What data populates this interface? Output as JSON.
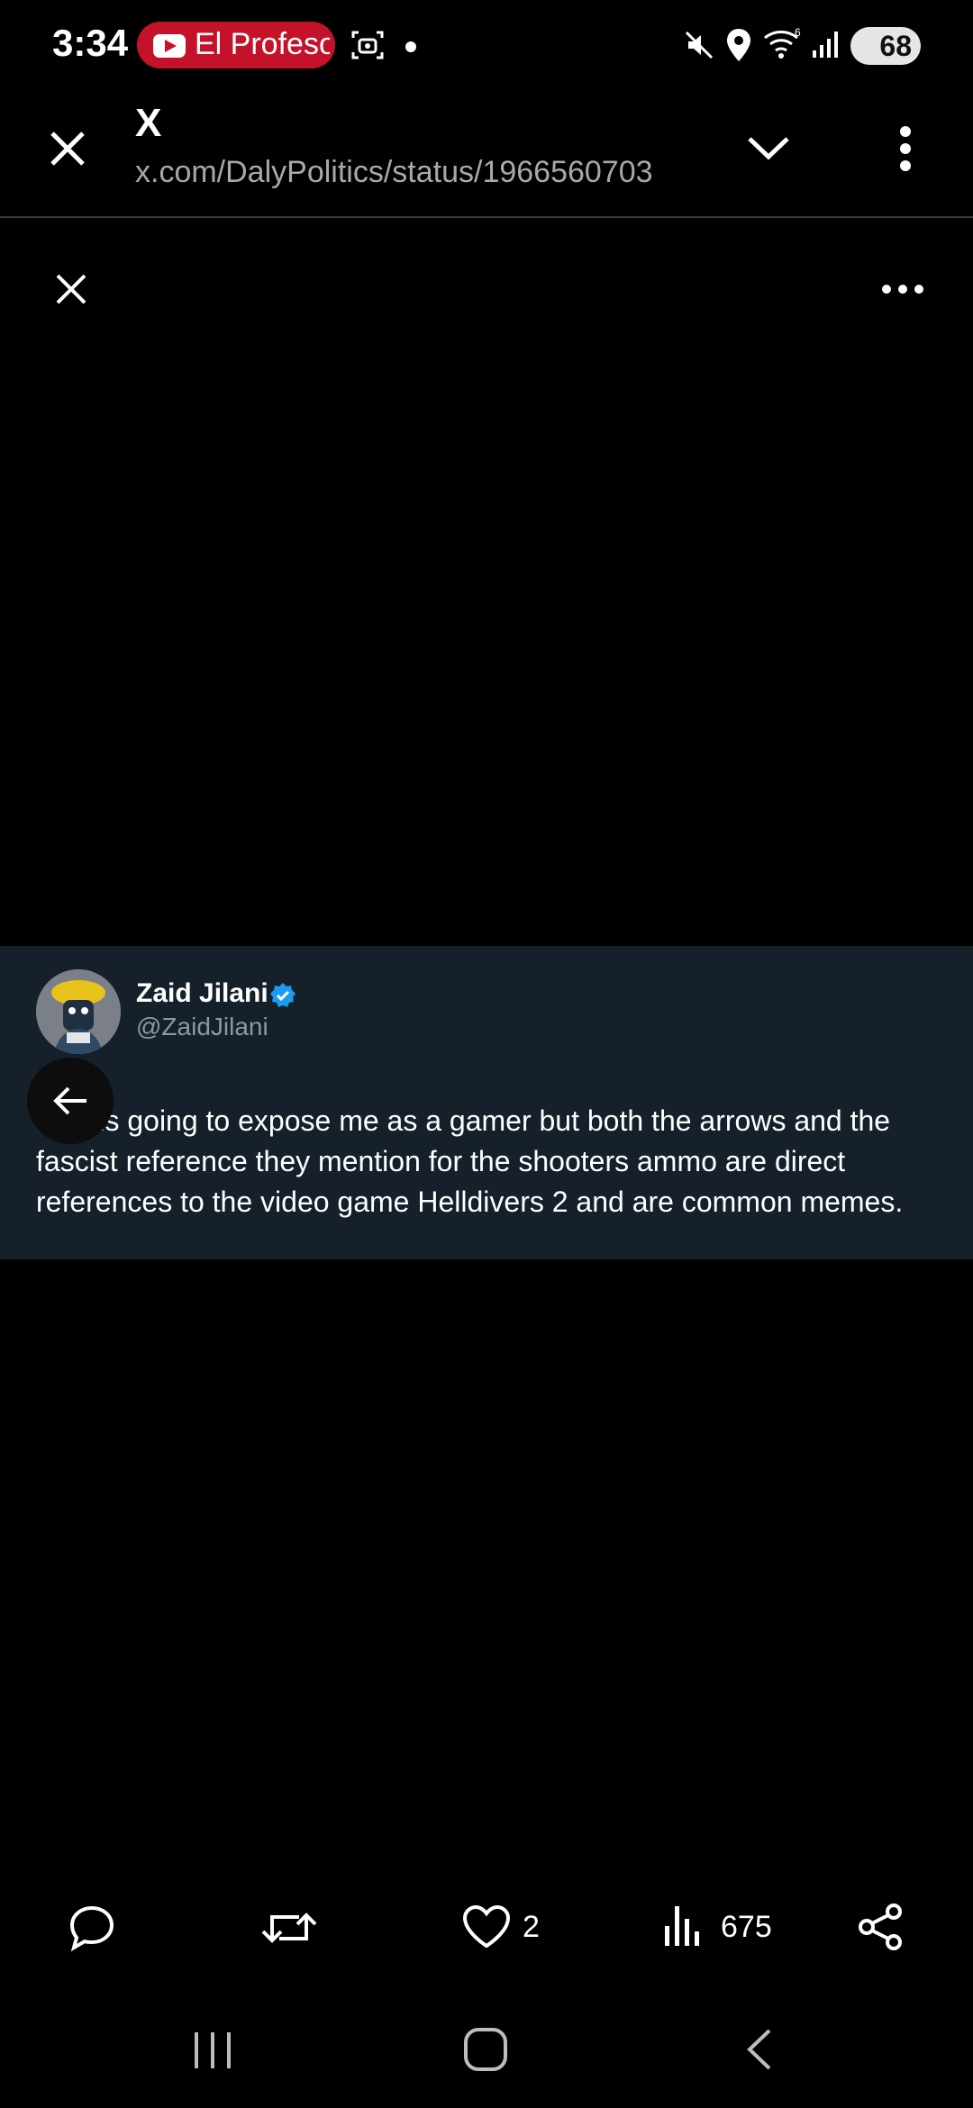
{
  "status_bar": {
    "time": "3:34",
    "notification_app": "El Profesor",
    "battery": "68",
    "icons": [
      "youtube-icon",
      "screenshot-icon",
      "mute-icon",
      "location-icon",
      "wifi-icon",
      "signal-icon",
      "battery-icon"
    ]
  },
  "browser": {
    "title": "X",
    "url": "x.com/DalyPolitics/status/1966560703"
  },
  "tweet": {
    "author_name": "Zaid Jilani",
    "handle": "@ZaidJilani",
    "verified": true,
    "text": "This is going to expose me as a gamer but both the arrows and the fascist reference they mention for the shooters ammo are direct references to the video game Helldivers 2 and are common memes."
  },
  "actions": {
    "likes": "2",
    "views": "675"
  },
  "colors": {
    "background": "#000000",
    "card": "#15202b",
    "verified_blue": "#1d9bf0",
    "youtube_red": "#c4122a"
  }
}
